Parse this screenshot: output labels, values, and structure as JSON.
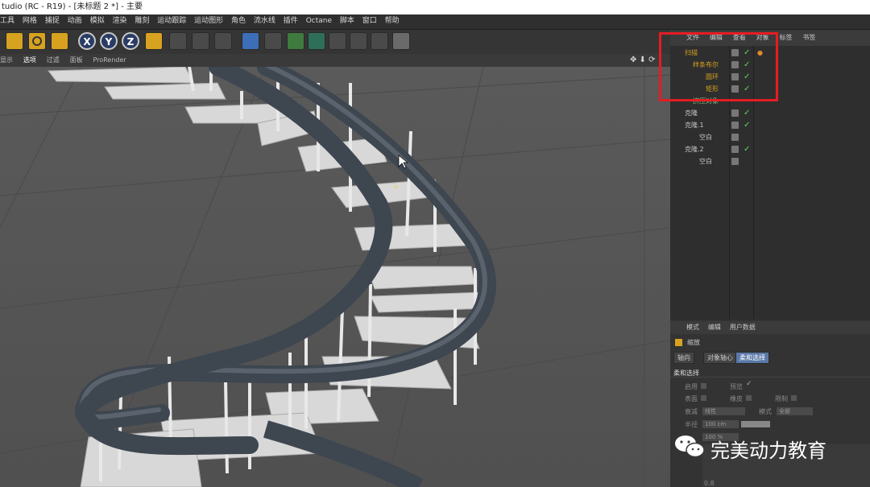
{
  "window": {
    "title": "tudio (RC - R19) - [未标题 2 *] - 主要"
  },
  "menu": [
    "工具",
    "网格",
    "捕捉",
    "动画",
    "模拟",
    "渲染",
    "雕刻",
    "运动跟踪",
    "运动图形",
    "角色",
    "流水线",
    "插件",
    "Octane",
    "脚本",
    "窗口",
    "帮助"
  ],
  "toolbar": {
    "x_label": "X",
    "y_label": "Y",
    "z_label": "Z"
  },
  "viewport_menu": [
    "显示",
    "选项",
    "过滤",
    "面板",
    "ProRender"
  ],
  "object_manager": {
    "tabs": [
      "文件",
      "编辑",
      "查看",
      "对象",
      "标签",
      "书签"
    ],
    "items": [
      {
        "name": "扫描",
        "color": "#d7a21f"
      },
      {
        "name": "样条布尔",
        "color": "#d7a21f"
      },
      {
        "name": "圆环",
        "color": "#d7a21f"
      },
      {
        "name": "矩形",
        "color": "#d7a21f"
      },
      {
        "name": "挤压对象",
        "color": "#7fc27f"
      },
      {
        "name": "克隆",
        "color": "#cfcfcf"
      },
      {
        "name": "克隆.1",
        "color": "#cfcfcf"
      },
      {
        "name": "空白",
        "color": "#cfcfcf"
      },
      {
        "name": "克隆.2",
        "color": "#cfcfcf"
      },
      {
        "name": "空白",
        "color": "#cfcfcf"
      }
    ]
  },
  "attributes": {
    "menu": [
      "模式",
      "编辑",
      "用户数据"
    ],
    "object_label": "缩放",
    "tabs": [
      "轴向",
      "对象轴心",
      "柔和选择"
    ],
    "section": "柔和选择",
    "enable_label": "启用",
    "preview_label": "预览",
    "surface_label": "表面",
    "rubber_label": "橡皮",
    "restrict_label": "限制",
    "falloff_label": "衰减",
    "falloff_value": "线性",
    "mode_label": "模式",
    "mode_value": "全部",
    "radius_label": "半径",
    "radius_value": "100 cm",
    "strength_value": "100 %",
    "graph_value": "0.8"
  },
  "watermark": {
    "text": "完美动力教育"
  },
  "colors": {
    "highlight": "#e51c23",
    "accent": "#d7a21f",
    "selected_tab": "#5a78a8"
  }
}
